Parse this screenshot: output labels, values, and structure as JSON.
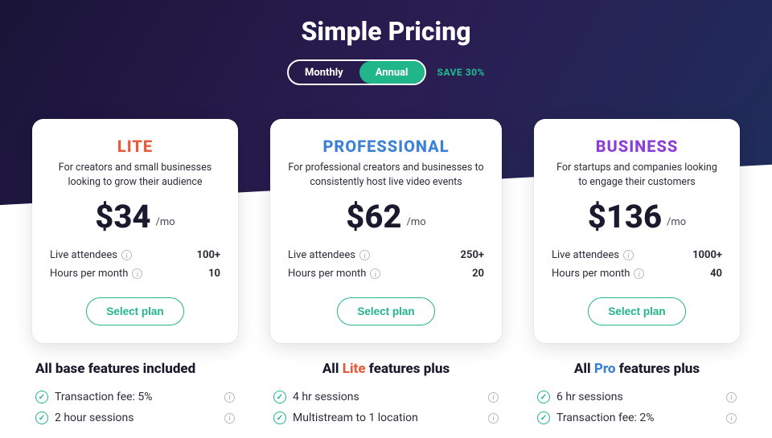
{
  "title": "Simple Pricing",
  "toggle": {
    "monthly": "Monthly",
    "annual": "Annual",
    "save": "SAVE 30%"
  },
  "stat_labels": {
    "attendees": "Live attendees",
    "hours": "Hours per month"
  },
  "per": "/mo",
  "select": "Select plan",
  "plans": {
    "lite": {
      "name": "LITE",
      "desc": "For creators and small businesses looking to grow their audience",
      "price": "$34",
      "attendees": "100+",
      "hours": "10",
      "features_title_pre": "All base features included",
      "features": [
        "Transaction fee: 5%",
        "2 hour sessions"
      ]
    },
    "pro": {
      "name": "PROFESSIONAL",
      "desc": "For professional creators and businesses to consistently host live video events",
      "price": "$62",
      "attendees": "250+",
      "hours": "20",
      "features_title_pre": "All ",
      "features_title_accent": "Lite",
      "features_title_post": " features plus",
      "features": [
        "4 hr sessions",
        "Multistream to 1 location"
      ]
    },
    "business": {
      "name": "BUSINESS",
      "desc": "For startups and companies looking to engage their customers",
      "price": "$136",
      "attendees": "1000+",
      "hours": "40",
      "features_title_pre": "All ",
      "features_title_accent": "Pro",
      "features_title_post": " features plus",
      "features": [
        "6 hr sessions",
        "Transaction fee: 2%"
      ]
    }
  }
}
